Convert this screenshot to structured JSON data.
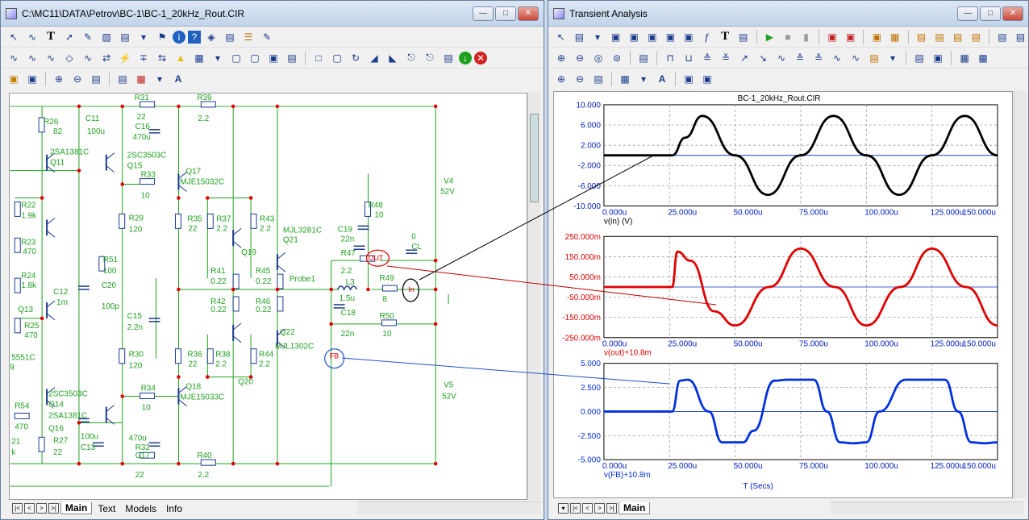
{
  "schematic_window": {
    "title": "C:\\MC11\\DATA\\Petrov\\BC-1\\BC-1_20kHz_Rout.CIR",
    "tabs": [
      "Main",
      "Text",
      "Models",
      "Info"
    ],
    "active_tab": "Main",
    "labels": [
      {
        "text": "R26",
        "c": "g"
      },
      {
        "text": "82",
        "c": "g"
      },
      {
        "text": "C11",
        "c": "g"
      },
      {
        "text": "100u",
        "c": "g"
      },
      {
        "text": "R31",
        "c": "g"
      },
      {
        "text": "22",
        "c": "g"
      },
      {
        "text": "C16",
        "c": "g"
      },
      {
        "text": "470u",
        "c": "g"
      },
      {
        "text": "R39",
        "c": "g"
      },
      {
        "text": "2.2",
        "c": "g"
      },
      {
        "text": "2SA1381C",
        "c": "g"
      },
      {
        "text": "Q11",
        "c": "g"
      },
      {
        "text": "2SC3503C",
        "c": "g"
      },
      {
        "text": "Q15",
        "c": "g"
      },
      {
        "text": "R33",
        "c": "g"
      },
      {
        "text": "10",
        "c": "g"
      },
      {
        "text": "Q17",
        "c": "g"
      },
      {
        "text": "MJE15032C",
        "c": "g"
      },
      {
        "text": "V4",
        "c": "g"
      },
      {
        "text": "52V",
        "c": "g"
      },
      {
        "text": "R22",
        "c": "g"
      },
      {
        "text": "1.9k",
        "c": "g"
      },
      {
        "text": "R29",
        "c": "g"
      },
      {
        "text": "120",
        "c": "g"
      },
      {
        "text": "R35",
        "c": "g"
      },
      {
        "text": "22",
        "c": "g"
      },
      {
        "text": "R37",
        "c": "g"
      },
      {
        "text": "2.2",
        "c": "g"
      },
      {
        "text": "R43",
        "c": "g"
      },
      {
        "text": "2.2",
        "c": "g"
      },
      {
        "text": "MJL3281C",
        "c": "g"
      },
      {
        "text": "Q21",
        "c": "g"
      },
      {
        "text": "R48",
        "c": "g"
      },
      {
        "text": "10",
        "c": "g"
      },
      {
        "text": "C19",
        "c": "g"
      },
      {
        "text": "22n",
        "c": "g"
      },
      {
        "text": "0",
        "c": "g"
      },
      {
        "text": "CL",
        "c": "g"
      },
      {
        "text": "R23",
        "c": "g"
      },
      {
        "text": "470",
        "c": "g"
      },
      {
        "text": "R51",
        "c": "g"
      },
      {
        "text": "100",
        "c": "g"
      },
      {
        "text": "C20",
        "c": "g"
      },
      {
        "text": "Q19",
        "c": "g"
      },
      {
        "text": "R47",
        "c": "g"
      },
      {
        "text": "2.2",
        "c": "g"
      },
      {
        "text": "OUT",
        "c": "r"
      },
      {
        "text": "R24",
        "c": "g"
      },
      {
        "text": "1.8k",
        "c": "g"
      },
      {
        "text": "C12",
        "c": "g"
      },
      {
        "text": "1m",
        "c": "g"
      },
      {
        "text": "100p",
        "c": "g"
      },
      {
        "text": "R41",
        "c": "g"
      },
      {
        "text": "0.22",
        "c": "g"
      },
      {
        "text": "R45",
        "c": "g"
      },
      {
        "text": "0.22",
        "c": "g"
      },
      {
        "text": "Probe1",
        "c": "g"
      },
      {
        "text": "L3",
        "c": "g"
      },
      {
        "text": "1.5u",
        "c": "g"
      },
      {
        "text": "R49",
        "c": "g"
      },
      {
        "text": "8",
        "c": "g"
      },
      {
        "text": "In",
        "c": "r"
      },
      {
        "text": "Q13",
        "c": "g"
      },
      {
        "text": "R25",
        "c": "g"
      },
      {
        "text": "470",
        "c": "g"
      },
      {
        "text": "R42",
        "c": "g"
      },
      {
        "text": "0.22",
        "c": "g"
      },
      {
        "text": "R46",
        "c": "g"
      },
      {
        "text": "0.22",
        "c": "g"
      },
      {
        "text": "C18",
        "c": "g"
      },
      {
        "text": "22n",
        "c": "g"
      },
      {
        "text": "R50",
        "c": "g"
      },
      {
        "text": "10",
        "c": "g"
      },
      {
        "text": "C15",
        "c": "g"
      },
      {
        "text": "2.2n",
        "c": "g"
      },
      {
        "text": "Q22",
        "c": "g"
      },
      {
        "text": "MJL1302C",
        "c": "g"
      },
      {
        "text": "5551C",
        "c": "g"
      },
      {
        "text": "9",
        "c": "g"
      },
      {
        "text": "R30",
        "c": "g"
      },
      {
        "text": "120",
        "c": "g"
      },
      {
        "text": "R36",
        "c": "g"
      },
      {
        "text": "22",
        "c": "g"
      },
      {
        "text": "R38",
        "c": "g"
      },
      {
        "text": "2.2",
        "c": "g"
      },
      {
        "text": "R44",
        "c": "g"
      },
      {
        "text": "2.2",
        "c": "g"
      },
      {
        "text": "FB",
        "c": "r"
      },
      {
        "text": "Q20",
        "c": "g"
      },
      {
        "text": "V5",
        "c": "g"
      },
      {
        "text": "52V",
        "c": "g"
      },
      {
        "text": "2SC3503C",
        "c": "g"
      },
      {
        "text": "Q14",
        "c": "g"
      },
      {
        "text": "R34",
        "c": "g"
      },
      {
        "text": "10",
        "c": "g"
      },
      {
        "text": "Q18",
        "c": "g"
      },
      {
        "text": "MJE15033C",
        "c": "g"
      },
      {
        "text": "R54",
        "c": "g"
      },
      {
        "text": "470",
        "c": "g"
      },
      {
        "text": "2SA1381C",
        "c": "g"
      },
      {
        "text": "Q16",
        "c": "g"
      },
      {
        "text": "21",
        "c": "g"
      },
      {
        "text": "k",
        "c": "g"
      },
      {
        "text": "R27",
        "c": "g"
      },
      {
        "text": "22",
        "c": "g"
      },
      {
        "text": "100u",
        "c": "g"
      },
      {
        "text": "C13",
        "c": "g"
      },
      {
        "text": "470u",
        "c": "g"
      },
      {
        "text": "R32",
        "c": "g"
      },
      {
        "text": "C17",
        "c": "g"
      },
      {
        "text": "22",
        "c": "g"
      },
      {
        "text": "R40",
        "c": "g"
      },
      {
        "text": "2.2",
        "c": "g"
      }
    ]
  },
  "analysis_window": {
    "title": "Transient Analysis",
    "plot_title": "BC-1_20kHz_Rout.CIR",
    "x_ticks": [
      "0.000u",
      "25.000u",
      "50.000u",
      "75.000u",
      "100.000u",
      "125.000u",
      "150.000u"
    ],
    "x_axis_label": "T (Secs)",
    "tab": "Main"
  },
  "chart_data": [
    {
      "type": "line",
      "series": [
        {
          "name": "v(in) (V)",
          "color": "#000000"
        }
      ],
      "yticks": [
        "10.000",
        "6.000",
        "2.000",
        "-2.000",
        "-6.000",
        "-10.000"
      ],
      "ylim": [
        -10,
        10
      ],
      "xlim": [
        0,
        150
      ],
      "x": [
        0,
        25,
        26,
        31,
        37.5,
        50,
        62.5,
        75,
        87.5,
        100,
        112.5,
        125,
        137.5,
        150
      ],
      "values": [
        0,
        0,
        0,
        3.5,
        7.8,
        0,
        -7.8,
        0,
        7.8,
        0,
        -7.8,
        0,
        7.8,
        0
      ]
    },
    {
      "type": "line",
      "series": [
        {
          "name": "v(out)+10.8m",
          "color": "#e00000"
        }
      ],
      "yticks": [
        "250.000m",
        "150.000m",
        "50.000m",
        "-50.000m",
        "-150.000m",
        "-250.000m"
      ],
      "ylim": [
        -250,
        250
      ],
      "xlim": [
        0,
        150
      ],
      "x": [
        0,
        25,
        26,
        28,
        33,
        42,
        50,
        63,
        75,
        88,
        100,
        113,
        125,
        138,
        150
      ],
      "values": [
        0,
        0,
        0,
        175,
        130,
        -120,
        -190,
        0,
        190,
        0,
        -190,
        0,
        190,
        0,
        -190
      ]
    },
    {
      "type": "line",
      "series": [
        {
          "name": "v(FB)+10.8m",
          "color": "#0030e0"
        }
      ],
      "yticks": [
        "5.000",
        "2.500",
        "0.000",
        "-2.500",
        "-5.000"
      ],
      "ylim": [
        -5,
        5
      ],
      "xlim": [
        0,
        150
      ],
      "x": [
        0,
        25,
        26,
        29,
        32,
        40,
        45,
        53,
        57,
        65,
        70,
        80,
        85,
        90,
        95,
        100,
        105,
        115,
        120,
        130,
        135,
        140,
        145,
        150
      ],
      "values": [
        0,
        0,
        0,
        3.2,
        3.3,
        0,
        -3.2,
        -3.2,
        -2,
        3.2,
        3.3,
        3.3,
        0,
        -3.2,
        -3.3,
        -3.2,
        0,
        3.3,
        3.3,
        3.3,
        0,
        -3.2,
        -3.3,
        -3.2
      ]
    }
  ]
}
